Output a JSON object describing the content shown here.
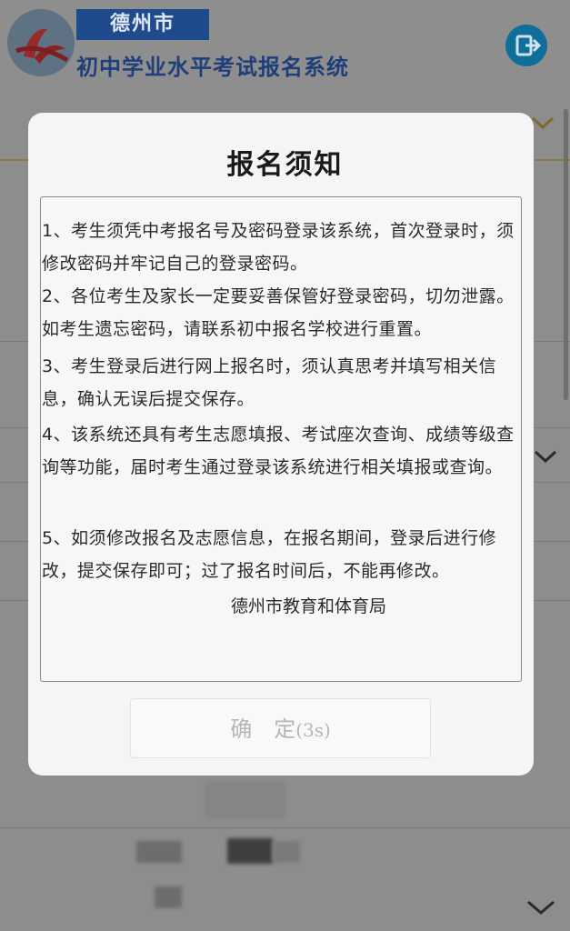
{
  "header": {
    "city": "德州市",
    "title": "初中学业水平考试报名系统"
  },
  "modal": {
    "title": "报名须知",
    "paragraphs": [
      "1、考生须凭中考报名号及密码登录该系统，首次登录时，须修改密码并牢记自己的登录密码。",
      "2、各位考生及家长一定要妥善保管好登录密码，切勿泄露。如考生遗忘密码，请联系初中报名学校进行重置。",
      "3、考生登录后进行网上报名时，须认真思考并填写相关信息，确认无误后提交保存。",
      "4、该系统还具有考生志愿填报、考试座次查询、成绩等级查询等功能，届时考生通过登录该系统进行相关填报或查询。",
      "5、如须修改报名及志愿信息，在报名期间，登录后进行修改，提交保存即可；过了报名时间后，不能再修改。"
    ],
    "signature": "德州市教育和体育局",
    "confirm_label": "确　定",
    "countdown": "(3s)"
  },
  "icons": {
    "logo": "ribbon-logo",
    "logout": "logout-icon",
    "chevron": "chevron-down-icon"
  },
  "colors": {
    "badge": "#1f4a8c",
    "title": "#1e3f7a",
    "logout": "#0f6f9a",
    "button_text": "#b6b6b6"
  }
}
